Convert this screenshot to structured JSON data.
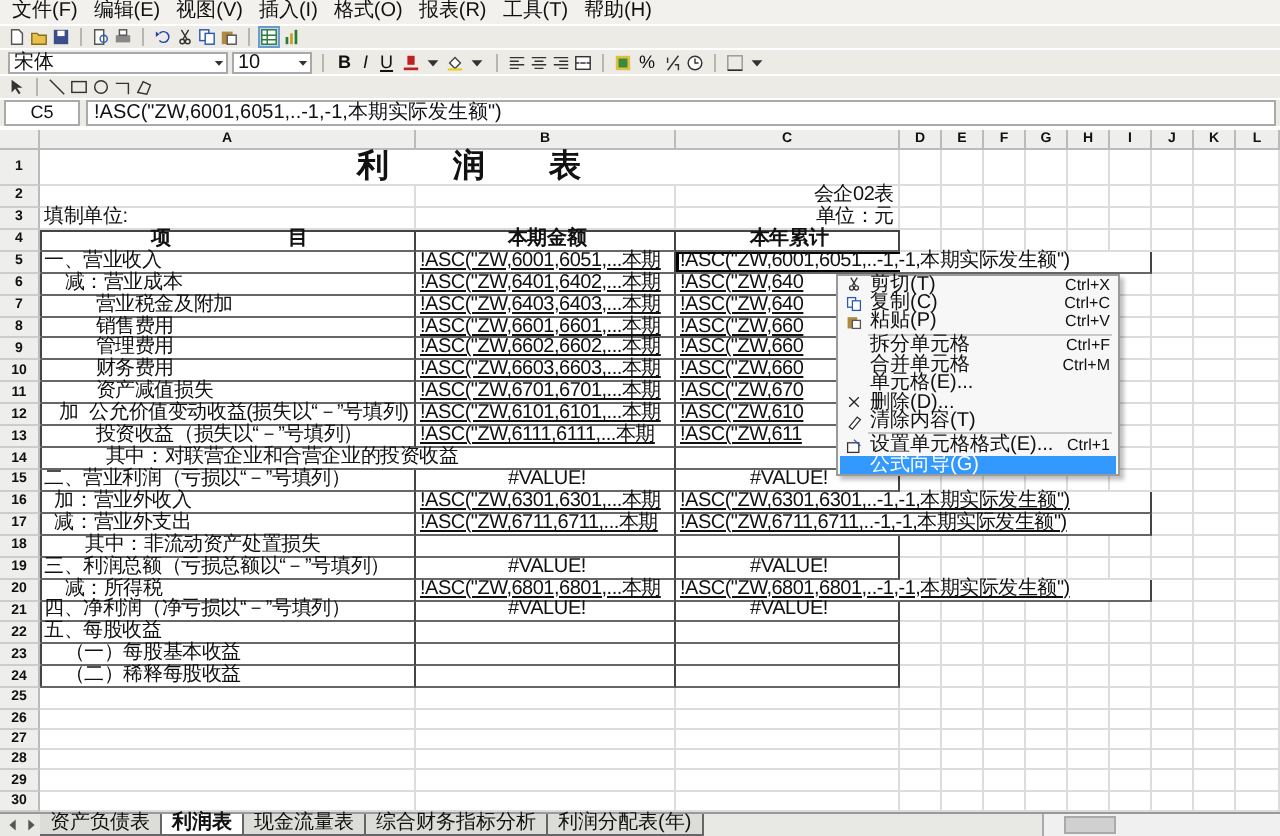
{
  "menu_bar": [
    "文件(F)",
    "编辑(E)",
    "视图(V)",
    "插入(I)",
    "格式(O)",
    "报表(R)",
    "工具(T)",
    "帮助(H)"
  ],
  "toolbar": {
    "font": "宋体",
    "font_size": "10",
    "style_buttons": [
      "B",
      "I",
      "U"
    ],
    "percent_button": "%"
  },
  "formula_bar": {
    "cell_ref": "C5",
    "formula": "!ASC(\"ZW,6001,6051,..-1,-1,本期实际发生额\")"
  },
  "sheet": {
    "columns": [
      "A",
      "B",
      "C",
      "D",
      "E",
      "F",
      "G",
      "H",
      "I",
      "J",
      "K",
      "L"
    ],
    "rows": [
      {
        "number": "1",
        "kind": "title",
        "title": "利　　润　　表"
      },
      {
        "number": "2",
        "kind": "note",
        "cells": [
          {
            "selected": false
          },
          {
            "selected": false
          },
          {
            "text": "会企02表",
            "selected": false
          }
        ]
      },
      {
        "number": "3",
        "kind": "note",
        "cells": [
          {
            "text": "填制单位:",
            "selected": false
          },
          {
            "selected": false
          },
          {
            "text": "单位：元",
            "selected": false
          }
        ]
      },
      {
        "number": "4",
        "kind": "header",
        "cells": [
          {
            "text": "项　　　　　　目",
            "selected": false
          },
          {
            "text": "本期金额",
            "selected": false
          },
          {
            "text": "本年累计",
            "selected": false
          }
        ]
      },
      {
        "number": "5",
        "kind": "body",
        "cells": [
          {
            "text": "一、营业收入",
            "selected": false
          },
          {
            "text": "!ASC(\"ZW,6001,6051,...本期",
            "selected": false
          },
          {
            "text": "!ASC(\"ZW,6001,6051,..-1,-1,本期实际发生额\")",
            "selected": true
          }
        ]
      },
      {
        "number": "6",
        "kind": "body",
        "cells": [
          {
            "text": "    减：营业成本",
            "selected": false
          },
          {
            "text": "!ASC(\"ZW,6401,6402,...本期",
            "selected": false
          },
          {
            "text": "!ASC(\"ZW,640",
            "selected": false
          }
        ]
      },
      {
        "number": "7",
        "kind": "body",
        "cells": [
          {
            "text": "          营业税金及附加",
            "selected": false
          },
          {
            "text": "!ASC(\"ZW,6403,6403,...本期",
            "selected": false
          },
          {
            "text": "!ASC(\"ZW,640",
            "selected": false
          }
        ]
      },
      {
        "number": "8",
        "kind": "body",
        "cells": [
          {
            "text": "          销售费用",
            "selected": false
          },
          {
            "text": "!ASC(\"ZW,6601,6601,...本期",
            "selected": false
          },
          {
            "text": "!ASC(\"ZW,660",
            "selected": false
          }
        ]
      },
      {
        "number": "9",
        "kind": "body",
        "cells": [
          {
            "text": "          管理费用",
            "selected": false
          },
          {
            "text": "!ASC(\"ZW,6602,6602,...本期",
            "selected": false
          },
          {
            "text": "!ASC(\"ZW,660",
            "selected": false
          }
        ]
      },
      {
        "number": "10",
        "kind": "body",
        "cells": [
          {
            "text": "          财务费用",
            "selected": false
          },
          {
            "text": "!ASC(\"ZW,6603,6603,...本期",
            "selected": false
          },
          {
            "text": "!ASC(\"ZW,660",
            "selected": false
          }
        ]
      },
      {
        "number": "11",
        "kind": "body",
        "cells": [
          {
            "text": "          资产减值损失",
            "selected": false
          },
          {
            "text": "!ASC(\"ZW,6701,6701,...本期",
            "selected": false
          },
          {
            "text": "!ASC(\"ZW,670",
            "selected": false
          }
        ]
      },
      {
        "number": "12",
        "kind": "body",
        "cells": [
          {
            "text": "   加  公允价值变动收益(损失以“－”号填列)",
            "selected": false
          },
          {
            "text": "!ASC(\"ZW,6101,6101,...本期",
            "selected": false
          },
          {
            "text": "!ASC(\"ZW,610",
            "selected": false
          }
        ]
      },
      {
        "number": "13",
        "kind": "body",
        "cells": [
          {
            "text": "          投资收益（损失以“－”号填列）",
            "selected": false
          },
          {
            "text": "!ASC(\"ZW,6111,6111,...本期",
            "selected": false
          },
          {
            "text": "!ASC(\"ZW,611",
            "selected": false
          }
        ]
      },
      {
        "number": "14",
        "kind": "body",
        "cells": [
          {
            "text": "            其中：对联营企业和合营企业的投资收益",
            "selected": false
          },
          {
            "selected": false
          },
          {
            "selected": false
          }
        ]
      },
      {
        "number": "15",
        "kind": "total",
        "cells": [
          {
            "text": "二、营业利润（亏损以“－”号填列）",
            "selected": false
          },
          {
            "text": "#VALUE!",
            "selected": false
          },
          {
            "text": "#VALUE!",
            "selected": false
          }
        ]
      },
      {
        "number": "16",
        "kind": "body",
        "cells": [
          {
            "text": "  加：营业外收入",
            "selected": false
          },
          {
            "text": "!ASC(\"ZW,6301,6301,...本期",
            "selected": false
          },
          {
            "text": "!ASC(\"ZW,6301,6301,..-1,-1,本期实际发生额\")",
            "selected": false
          }
        ]
      },
      {
        "number": "17",
        "kind": "body",
        "cells": [
          {
            "text": "  减：营业外支出",
            "selected": false
          },
          {
            "text": "!ASC(\"ZW,6711,6711,...本期",
            "selected": false
          },
          {
            "text": "!ASC(\"ZW,6711,6711,..-1,-1,本期实际发生额\")",
            "selected": false
          }
        ]
      },
      {
        "number": "18",
        "kind": "body",
        "cells": [
          {
            "text": "        其中：非流动资产处置损失",
            "selected": false
          },
          {
            "selected": false
          },
          {
            "selected": false
          }
        ]
      },
      {
        "number": "19",
        "kind": "total",
        "cells": [
          {
            "text": "三、利润总额（亏损总额以“－”号填列）",
            "selected": false
          },
          {
            "text": "#VALUE!",
            "selected": false
          },
          {
            "text": "#VALUE!",
            "selected": false
          }
        ]
      },
      {
        "number": "20",
        "kind": "body",
        "cells": [
          {
            "text": "    减：所得税",
            "selected": false
          },
          {
            "text": "!ASC(\"ZW,6801,6801,...本期",
            "selected": false
          },
          {
            "text": "!ASC(\"ZW,6801,6801,..-1,-1,本期实际发生额\")",
            "selected": false
          }
        ]
      },
      {
        "number": "21",
        "kind": "total",
        "cells": [
          {
            "text": "四、净利润（净亏损以“－”号填列）",
            "selected": false
          },
          {
            "text": "#VALUE!",
            "selected": false
          },
          {
            "text": "#VALUE!",
            "selected": false
          }
        ]
      },
      {
        "number": "22",
        "kind": "body",
        "cells": [
          {
            "text": "五、每股收益",
            "selected": false
          },
          {
            "selected": false
          },
          {
            "selected": false
          }
        ]
      },
      {
        "number": "23",
        "kind": "body",
        "cells": [
          {
            "text": "    （一）每股基本收益",
            "selected": false
          },
          {
            "selected": false
          },
          {
            "selected": false
          }
        ]
      },
      {
        "number": "24",
        "kind": "body",
        "cells": [
          {
            "text": "    （二）稀释每股收益",
            "selected": false
          },
          {
            "selected": false
          },
          {
            "selected": false
          }
        ]
      },
      {
        "number": "25",
        "kind": "plain"
      },
      {
        "number": "26",
        "kind": "plain"
      },
      {
        "number": "27",
        "kind": "plain"
      },
      {
        "number": "28",
        "kind": "plain"
      },
      {
        "number": "29",
        "kind": "plain"
      },
      {
        "number": "30",
        "kind": "plain"
      }
    ]
  },
  "context_menu": {
    "groups": [
      [
        {
          "label": "剪切(T)",
          "shortcut": "Ctrl+X",
          "kind": "cut",
          "selected": false
        },
        {
          "label": "复制(C)",
          "shortcut": "Ctrl+C",
          "kind": "copy",
          "selected": false
        },
        {
          "label": "粘贴(P)",
          "shortcut": "Ctrl+V",
          "kind": "paste",
          "selected": false
        }
      ],
      [
        {
          "label": "拆分单元格",
          "shortcut": "Ctrl+F",
          "kind": "plain",
          "selected": false
        },
        {
          "label": "合并单元格",
          "shortcut": "Ctrl+M",
          "kind": "plain",
          "selected": false
        },
        {
          "label": "单元格(E)...",
          "kind": "plain",
          "selected": false
        },
        {
          "label": "删除(D)...",
          "kind": "delete",
          "selected": false
        },
        {
          "label": "清除内容(T)",
          "kind": "clear",
          "selected": false
        }
      ],
      [
        {
          "label": "设置单元格格式(E)...",
          "shortcut": "Ctrl+1",
          "kind": "format",
          "selected": false
        },
        {
          "label": "公式向导(G)",
          "kind": "plain",
          "selected": true
        }
      ]
    ]
  },
  "sheet_tabs": [
    {
      "label": "资产负债表",
      "selected": false
    },
    {
      "label": "利润表",
      "selected": true
    },
    {
      "label": "现金流量表",
      "selected": false
    },
    {
      "label": "综合财务指标分析",
      "selected": false
    },
    {
      "label": "利润分配表(年)",
      "selected": false
    }
  ]
}
